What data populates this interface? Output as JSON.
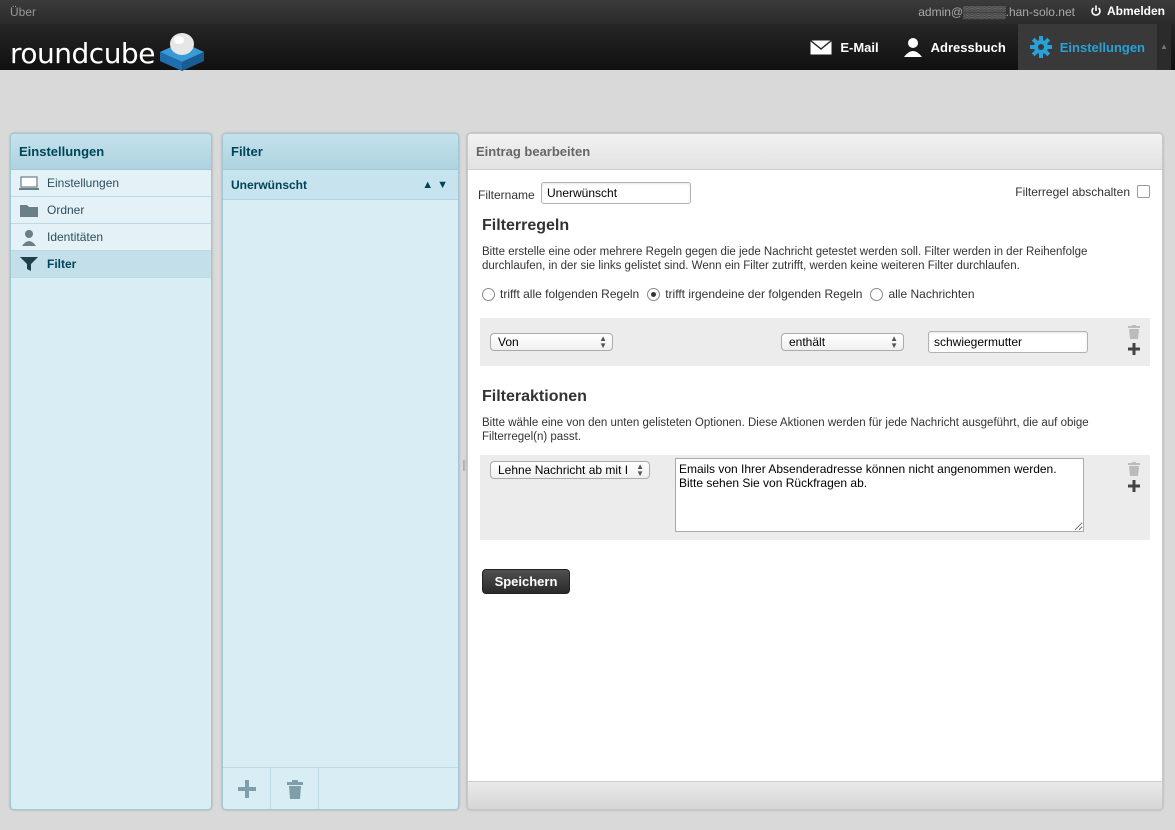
{
  "topline": {
    "about": "Über",
    "user": "admin@▒▒▒▒▒.han-solo.net",
    "logout": "Abmelden"
  },
  "header": {
    "logo_text": "roundcube",
    "tasks": [
      {
        "label": "E-Mail",
        "icon": "envelope-icon"
      },
      {
        "label": "Adressbuch",
        "icon": "person-icon"
      },
      {
        "label": "Einstellungen",
        "icon": "gear-icon",
        "active": true
      }
    ]
  },
  "settings_panel": {
    "title": "Einstellungen",
    "items": [
      {
        "label": "Einstellungen",
        "icon": "monitor-icon"
      },
      {
        "label": "Ordner",
        "icon": "folder-icon"
      },
      {
        "label": "Identitäten",
        "icon": "user-icon"
      },
      {
        "label": "Filter",
        "icon": "funnel-icon",
        "selected": true
      }
    ]
  },
  "filter_panel": {
    "title": "Filter",
    "filters": [
      {
        "label": "Unerwünscht"
      }
    ],
    "up_arrow": "▲",
    "down_arrow": "▼"
  },
  "edit_panel": {
    "title": "Eintrag bearbeiten",
    "filtername_label": "Filtername",
    "filtername_value": "Unerwünscht",
    "disable_label": "Filterregel abschalten",
    "rules_heading": "Filterregeln",
    "rules_desc": "Bitte erstelle eine oder mehrere Regeln gegen die jede Nachricht getestet werden soll. Filter werden in der Reihenfolge durchlaufen, in der sie links gelistet sind. Wenn ein Filter zutrifft, werden keine weiteren Filter durchlaufen.",
    "radio_options": [
      {
        "label": "trifft alle folgenden Regeln",
        "checked": false
      },
      {
        "label": "trifft irgendeine der folgenden Regeln",
        "checked": true
      },
      {
        "label": "alle Nachrichten",
        "checked": false
      }
    ],
    "rule": {
      "field": "Von",
      "operator": "enthält",
      "value": "schwiegermutter"
    },
    "actions_heading": "Filteraktionen",
    "actions_desc": "Bitte wähle eine von den unten gelisteten Optionen. Diese Aktionen werden für jede Nachricht ausgeführt, die auf obige Filterregel(n) passt.",
    "action": {
      "type": "Lehne Nachricht ab mit I",
      "message": "Emails von Ihrer Absenderadresse können nicht angenommen werden.\nBitte sehen Sie von Rückfragen ab."
    },
    "save_label": "Speichern"
  }
}
